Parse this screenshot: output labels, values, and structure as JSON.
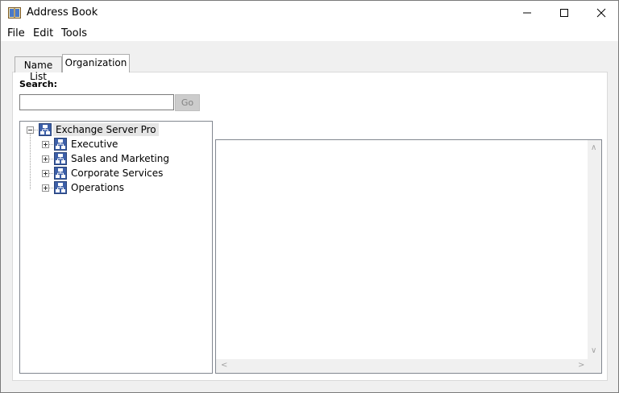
{
  "window": {
    "title": "Address Book"
  },
  "menu": [
    "File",
    "Edit",
    "Tools"
  ],
  "tabs": [
    {
      "label": "Name List",
      "active": false
    },
    {
      "label": "Organization",
      "active": true
    }
  ],
  "search": {
    "label": "Search:",
    "value": "",
    "go_label": "Go",
    "go_enabled": false
  },
  "tree": {
    "root": {
      "label": "Exchange Server Pro",
      "expanded": true,
      "icon": "org-chart-icon"
    },
    "children": [
      {
        "label": "Executive",
        "expanded": false,
        "icon": "org-chart-icon"
      },
      {
        "label": "Sales and Marketing",
        "expanded": false,
        "icon": "org-chart-icon"
      },
      {
        "label": "Corporate Services",
        "expanded": false,
        "icon": "org-chart-icon"
      },
      {
        "label": "Operations",
        "expanded": false,
        "icon": "org-chart-icon"
      }
    ]
  },
  "colors": {
    "accent": "#3c5fa8",
    "selection": "#e5e5e5",
    "border": "#828790"
  }
}
